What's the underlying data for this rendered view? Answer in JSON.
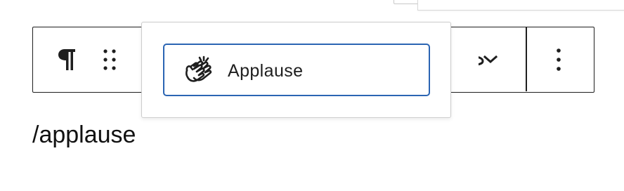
{
  "icons": {
    "paragraph": "paragraph-icon",
    "drag": "drag-handle-icon",
    "chevron": "chevron-down-icon",
    "more": "more-vertical-icon",
    "applause": "applause-hands-icon"
  },
  "autocomplete": {
    "options": [
      {
        "label": "Applause",
        "icon": "applause-hands-icon"
      }
    ]
  },
  "paragraph": {
    "text": "/applause"
  },
  "colors": {
    "accent": "#2b65b3",
    "text": "#1e1e1e",
    "border": "#1e1e1e"
  }
}
